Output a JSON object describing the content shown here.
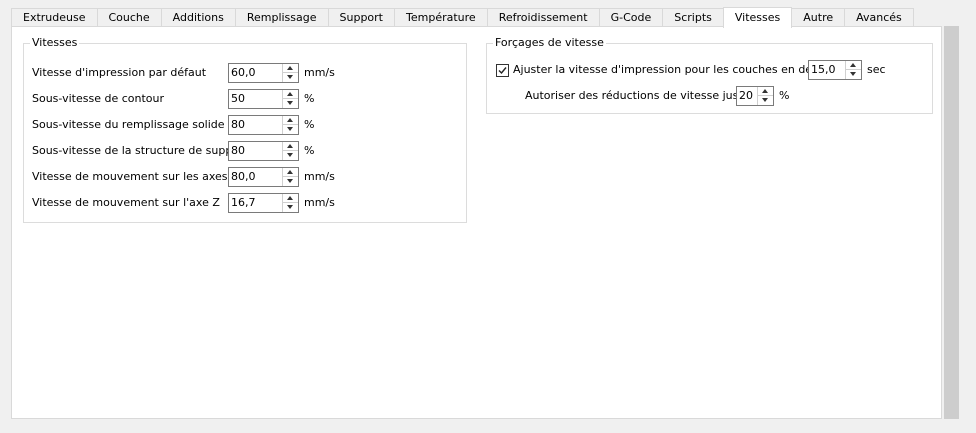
{
  "tabs": [
    {
      "label": "Extrudeuse"
    },
    {
      "label": "Couche"
    },
    {
      "label": "Additions"
    },
    {
      "label": "Remplissage"
    },
    {
      "label": "Support"
    },
    {
      "label": "Température"
    },
    {
      "label": "Refroidissement"
    },
    {
      "label": "G-Code"
    },
    {
      "label": "Scripts"
    },
    {
      "label": "Vitesses"
    },
    {
      "label": "Autre"
    },
    {
      "label": "Avancés"
    }
  ],
  "active_tab": "Vitesses",
  "vitesses_group": {
    "title": "Vitesses",
    "rows": [
      {
        "label": "Vitesse d'impression par défaut",
        "value": "60,0",
        "unit": "mm/s"
      },
      {
        "label": "Sous-vitesse de contour",
        "value": "50",
        "unit": "%"
      },
      {
        "label": "Sous-vitesse du remplissage solide",
        "value": "80",
        "unit": "%"
      },
      {
        "label": "Sous-vitesse de la structure de support",
        "value": "80",
        "unit": "%"
      },
      {
        "label": "Vitesse de mouvement sur les axes X/Y",
        "value": "80,0",
        "unit": "mm/s"
      },
      {
        "label": "Vitesse de mouvement sur l'axe Z",
        "value": "16,7",
        "unit": "mm/s"
      }
    ]
  },
  "forcages_group": {
    "title": "Forçages de vitesse",
    "adjust": {
      "label": "Ajuster la vitesse d'impression pour les couches en dessous",
      "checked": true,
      "value": "15,0",
      "unit": "sec"
    },
    "reduction": {
      "label": "Autoriser des réductions de vitesse jusqu'à",
      "value": "20",
      "unit": "%"
    }
  }
}
